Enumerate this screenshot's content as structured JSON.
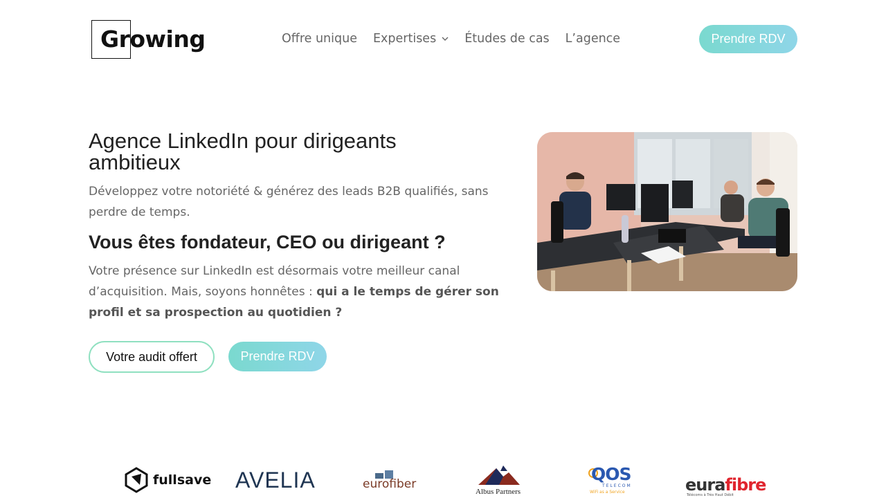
{
  "header": {
    "logo_text": "Growing",
    "nav": [
      {
        "label": "Offre unique"
      },
      {
        "label": "Expertises",
        "has_dropdown": true
      },
      {
        "label": "Études de cas"
      },
      {
        "label": "L’agence"
      }
    ],
    "cta_label": "Prendre RDV"
  },
  "hero": {
    "title": "Agence LinkedIn pour dirigeants ambitieux",
    "subtitle": "Développez votre notoriété & générez des leads B2B qualifiés, sans perdre de temps.",
    "question": "Vous êtes fondateur, CEO ou dirigeant ?",
    "paragraph_plain": "Votre présence sur LinkedIn est désormais votre meilleur canal d’acquisition. Mais, soyons honnêtes : ",
    "paragraph_bold": "qui a le temps de gérer son profil et sa prospection au quotidien ?",
    "btn_audit": "Votre audit offert",
    "btn_rdv": "Prendre RDV"
  },
  "client_logos": [
    {
      "name": "fullsave",
      "text": "fullsave"
    },
    {
      "name": "avelia",
      "text": "AVELIA"
    },
    {
      "name": "eurofiber",
      "text": "eurofiber"
    },
    {
      "name": "albus-partners",
      "text": "Albus Partners"
    },
    {
      "name": "qos-telecom",
      "text": "QOS",
      "sub": "TELECOM",
      "tagline": "WiFi as a Service"
    },
    {
      "name": "eurafibre",
      "text_dark": "eura",
      "text_red": "fibre",
      "tagline": "Télécoms à Très Haut Débit"
    }
  ],
  "colors": {
    "accent_gradient_start": "#7ad9cf",
    "accent_gradient_end": "#8fd6e8",
    "audit_border": "#8fe0c0",
    "text_dark": "#222222",
    "text_muted": "#666666"
  }
}
